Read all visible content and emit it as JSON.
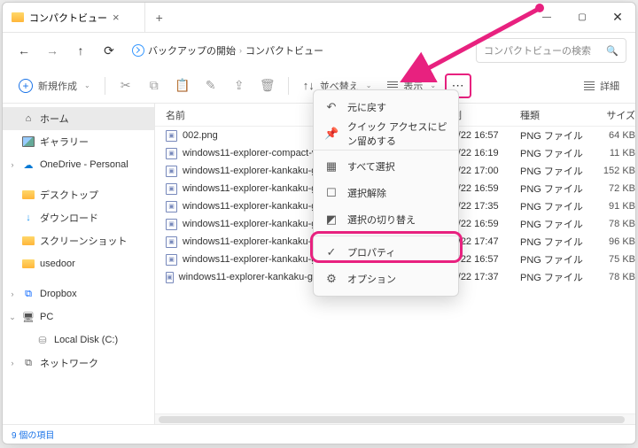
{
  "titlebar": {
    "tab_title": "コンパクトビュー"
  },
  "nav": {
    "breadcrumb": [
      "バックアップの開始",
      "コンパクトビュー"
    ],
    "search_placeholder": "コンパクトビューの検索"
  },
  "toolbar": {
    "new_label": "新規作成",
    "sort_label": "並べ替え",
    "view_label": "表示",
    "details_label": "詳細"
  },
  "sidebar": {
    "home": "ホーム",
    "gallery": "ギャラリー",
    "onedrive": "OneDrive - Personal",
    "desktop": "デスクトップ",
    "downloads": "ダウンロード",
    "screenshots": "スクリーンショット",
    "usedoor": "usedoor",
    "dropbox": "Dropbox",
    "pc": "PC",
    "localdisk": "Local Disk (C:)",
    "network": "ネットワーク"
  },
  "columns": {
    "name": "名前",
    "date": "日付時刻",
    "type": "種類",
    "size": "サイズ"
  },
  "files": [
    {
      "name": "002.png",
      "date": "2024/07/22 16:57",
      "type": "PNG ファイル",
      "size": "64 KB"
    },
    {
      "name": "windows11-explorer-compact-vi",
      "date": "2024/07/22 16:19",
      "type": "PNG ファイル",
      "size": "11 KB"
    },
    {
      "name": "windows11-explorer-kankaku-gy",
      "date": "2024/07/22 17:00",
      "type": "PNG ファイル",
      "size": "152 KB"
    },
    {
      "name": "windows11-explorer-kankaku-gy",
      "date": "2024/07/22 16:59",
      "type": "PNG ファイル",
      "size": "72 KB"
    },
    {
      "name": "windows11-explorer-kankaku-gy",
      "date": "2024/07/22 17:35",
      "type": "PNG ファイル",
      "size": "91 KB"
    },
    {
      "name": "windows11-explorer-kankaku-gy",
      "date": "2024/07/22 16:59",
      "type": "PNG ファイル",
      "size": "78 KB"
    },
    {
      "name": "windows11-explorer-kankaku-gy",
      "date": "2024/07/22 17:47",
      "type": "PNG ファイル",
      "size": "96 KB"
    },
    {
      "name": "windows11-explorer-kankaku-gy",
      "date": "2024/07/22 16:57",
      "type": "PNG ファイル",
      "size": "75 KB"
    },
    {
      "name": "windows11-explorer-kankaku-gyoukan-compact-view-10.png",
      "date": "2024/07/22 17:37",
      "type": "PNG ファイル",
      "size": "78 KB"
    }
  ],
  "context_menu": {
    "undo": "元に戻す",
    "pin": "クイック アクセスにピン留めする",
    "select_all": "すべて選択",
    "select_none": "選択解除",
    "invert": "選択の切り替え",
    "properties": "プロパティ",
    "options": "オプション"
  },
  "status": {
    "count": "9 個の項目"
  }
}
